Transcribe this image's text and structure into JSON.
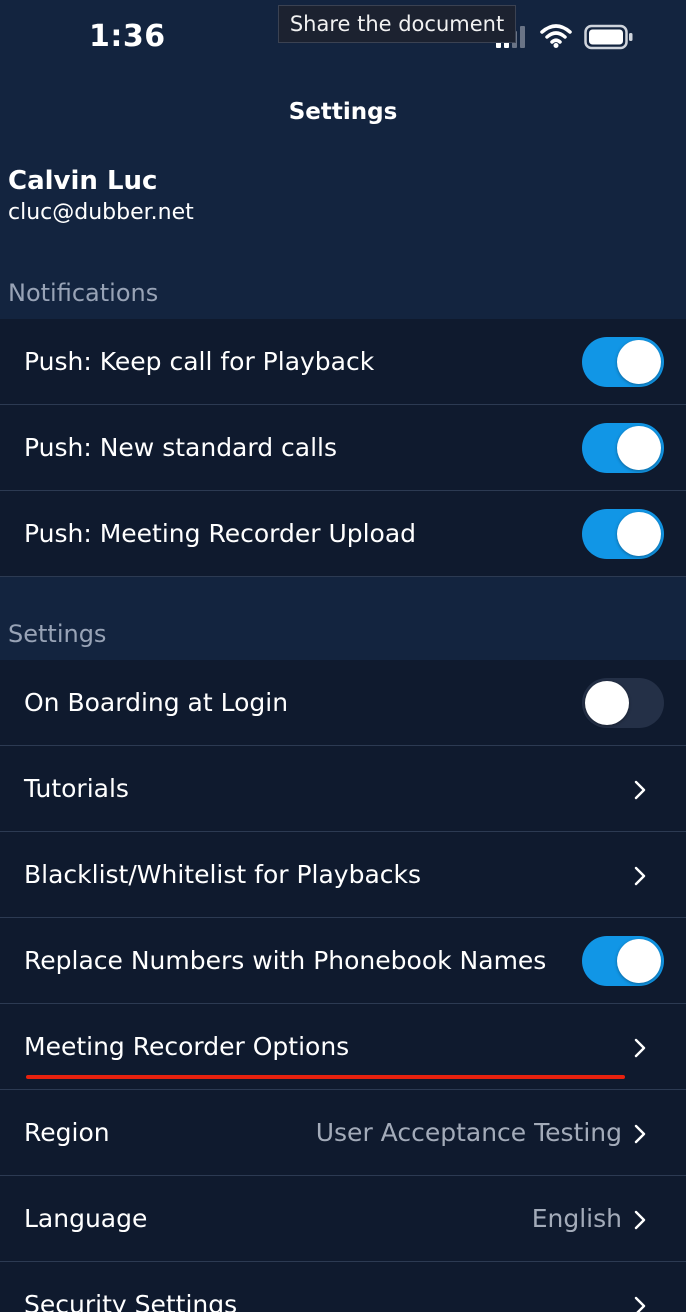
{
  "status_bar": {
    "time": "1:36",
    "tooltip": "Share the document"
  },
  "nav": {
    "title": "Settings"
  },
  "profile": {
    "name": "Calvin Luc",
    "email": "cluc@dubber.net"
  },
  "notifications": {
    "header": "Notifications",
    "items": [
      {
        "label": "Push: Keep call for Playback",
        "toggle": "on"
      },
      {
        "label": "Push: New standard calls",
        "toggle": "on"
      },
      {
        "label": "Push: Meeting Recorder Upload",
        "toggle": "on"
      }
    ]
  },
  "settings": {
    "header": "Settings",
    "items": [
      {
        "label": "On Boarding at Login",
        "toggle": "off"
      },
      {
        "label": "Tutorials"
      },
      {
        "label": "Blacklist/Whitelist for Playbacks"
      },
      {
        "label": "Replace Numbers with Phonebook Names",
        "toggle": "on"
      },
      {
        "label": "Meeting Recorder Options"
      },
      {
        "label": "Region",
        "value": "User Acceptance Testing"
      },
      {
        "label": "Language",
        "value": "English"
      },
      {
        "label": "Security Settings"
      }
    ]
  },
  "colors": {
    "background": "#13243f",
    "row_background": "#0f1a2e",
    "toggle_on": "#1196e6",
    "highlight": "#e8210e"
  }
}
